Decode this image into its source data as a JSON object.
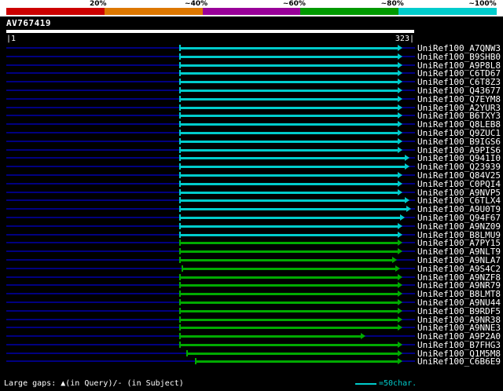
{
  "scale_bar": {
    "labels": [
      "20%",
      "~40%",
      "~60%",
      "~80%",
      "~100%"
    ],
    "colors": [
      "#cc0000",
      "#dd7700",
      "#990099",
      "#009900",
      "#00cccc"
    ]
  },
  "query": {
    "name": "AV767419",
    "ruler_left": "|1",
    "ruler_right": "323|",
    "length": 323
  },
  "footer": {
    "gaps_legend": "Large gaps: ▲(in Query)/- (in Subject)",
    "scale_legend": "=50char.",
    "scale_color": "#00cccc"
  },
  "chart_data": {
    "type": "bar",
    "subtype": "blast-alignment-overview",
    "query_name": "AV767419",
    "query_length": 323,
    "identity_legend": [
      {
        "label": "20%",
        "color": "#cc0000",
        "range": "0-20%"
      },
      {
        "label": "~40%",
        "color": "#dd7700",
        "range": "20-40%"
      },
      {
        "label": "~60%",
        "color": "#990099",
        "range": "40-60%"
      },
      {
        "label": "~80%",
        "color": "#009900",
        "range": "60-80%"
      },
      {
        "label": "~100%",
        "color": "#00cccc",
        "range": "80-100%"
      }
    ],
    "hits": [
      {
        "label": "UniRef100_A7QNW3",
        "start": 137,
        "end": 311,
        "identity": "80-100%",
        "color": "#00cccc"
      },
      {
        "label": "UniRef100_B9SHB0",
        "start": 137,
        "end": 311,
        "identity": "80-100%",
        "color": "#00cccc"
      },
      {
        "label": "UniRef100_A9P8L8",
        "start": 137,
        "end": 311,
        "identity": "80-100%",
        "color": "#00cccc"
      },
      {
        "label": "UniRef100_C6TD67",
        "start": 137,
        "end": 311,
        "identity": "80-100%",
        "color": "#00cccc"
      },
      {
        "label": "UniRef100_C6T8Z3",
        "start": 137,
        "end": 311,
        "identity": "80-100%",
        "color": "#00cccc"
      },
      {
        "label": "UniRef100_Q43677",
        "start": 137,
        "end": 311,
        "identity": "80-100%",
        "color": "#00cccc"
      },
      {
        "label": "UniRef100_Q7EYM8",
        "start": 137,
        "end": 311,
        "identity": "80-100%",
        "color": "#00cccc"
      },
      {
        "label": "UniRef100_A2YUR3",
        "start": 137,
        "end": 311,
        "identity": "80-100%",
        "color": "#00cccc"
      },
      {
        "label": "UniRef100_B6TXY3",
        "start": 137,
        "end": 311,
        "identity": "80-100%",
        "color": "#00cccc"
      },
      {
        "label": "UniRef100_Q8LEB8",
        "start": 137,
        "end": 311,
        "identity": "80-100%",
        "color": "#00cccc"
      },
      {
        "label": "UniRef100_Q9ZUC1",
        "start": 137,
        "end": 311,
        "identity": "80-100%",
        "color": "#00cccc"
      },
      {
        "label": "UniRef100_B9IGS6",
        "start": 137,
        "end": 311,
        "identity": "80-100%",
        "color": "#00cccc"
      },
      {
        "label": "UniRef100_A9PIS6",
        "start": 137,
        "end": 311,
        "identity": "80-100%",
        "color": "#00cccc"
      },
      {
        "label": "UniRef100_Q941I0",
        "start": 137,
        "end": 317,
        "identity": "80-100%",
        "color": "#00cccc"
      },
      {
        "label": "UniRef100_Q23939",
        "start": 137,
        "end": 317,
        "identity": "80-100%",
        "color": "#00cccc"
      },
      {
        "label": "UniRef100_Q84V25",
        "start": 137,
        "end": 311,
        "identity": "80-100%",
        "color": "#00cccc"
      },
      {
        "label": "UniRef100_C0PQI4",
        "start": 137,
        "end": 311,
        "identity": "80-100%",
        "color": "#00cccc"
      },
      {
        "label": "UniRef100_A9NVP5",
        "start": 137,
        "end": 311,
        "identity": "80-100%",
        "color": "#00cccc"
      },
      {
        "label": "UniRef100_C6TLX4",
        "start": 137,
        "end": 317,
        "identity": "80-100%",
        "color": "#00cccc"
      },
      {
        "label": "UniRef100_A9U0T9",
        "start": 137,
        "end": 318,
        "identity": "80-100%",
        "color": "#00cccc"
      },
      {
        "label": "UniRef100_Q94F67",
        "start": 137,
        "end": 313,
        "identity": "80-100%",
        "color": "#00cccc"
      },
      {
        "label": "UniRef100_A9NZ09",
        "start": 137,
        "end": 311,
        "identity": "80-100%",
        "color": "#00cccc"
      },
      {
        "label": "UniRef100_B8LMU9",
        "start": 137,
        "end": 311,
        "identity": "80-100%",
        "color": "#00cccc"
      },
      {
        "label": "UniRef100_A7PY15",
        "start": 137,
        "end": 311,
        "identity": "60-80%",
        "color": "#00aa00"
      },
      {
        "label": "UniRef100_A9NLT9",
        "start": 137,
        "end": 311,
        "identity": "60-80%",
        "color": "#00aa00"
      },
      {
        "label": "UniRef100_A9NLA7",
        "start": 137,
        "end": 307,
        "identity": "60-80%",
        "color": "#00aa00"
      },
      {
        "label": "UniRef100_A9S4C2",
        "start": 139,
        "end": 309,
        "identity": "60-80%",
        "color": "#00aa00"
      },
      {
        "label": "UniRef100_A9NZF8",
        "start": 137,
        "end": 311,
        "identity": "60-80%",
        "color": "#00aa00"
      },
      {
        "label": "UniRef100_A9NR79",
        "start": 137,
        "end": 311,
        "identity": "60-80%",
        "color": "#00aa00"
      },
      {
        "label": "UniRef100_B8LMT8",
        "start": 137,
        "end": 311,
        "identity": "60-80%",
        "color": "#00aa00"
      },
      {
        "label": "UniRef100_A9NU44",
        "start": 137,
        "end": 311,
        "identity": "60-80%",
        "color": "#00aa00"
      },
      {
        "label": "UniRef100_B9RDF5",
        "start": 137,
        "end": 311,
        "identity": "60-80%",
        "color": "#00aa00"
      },
      {
        "label": "UniRef100_A9NR38",
        "start": 137,
        "end": 311,
        "identity": "60-80%",
        "color": "#00aa00"
      },
      {
        "label": "UniRef100_A9NNE3",
        "start": 137,
        "end": 311,
        "identity": "60-80%",
        "color": "#00aa00"
      },
      {
        "label": "UniRef100_A9P2A0",
        "start": 137,
        "end": 282,
        "identity": "60-80%",
        "color": "#00aa00"
      },
      {
        "label": "UniRef100_B7FHG3",
        "start": 137,
        "end": 311,
        "identity": "60-80%",
        "color": "#00aa00"
      },
      {
        "label": "UniRef100_Q1M5M8",
        "start": 143,
        "end": 311,
        "identity": "60-80%",
        "color": "#00aa00"
      },
      {
        "label": "UniRef100_C6B6E9",
        "start": 150,
        "end": 311,
        "identity": "60-80%",
        "color": "#00aa00"
      }
    ]
  }
}
